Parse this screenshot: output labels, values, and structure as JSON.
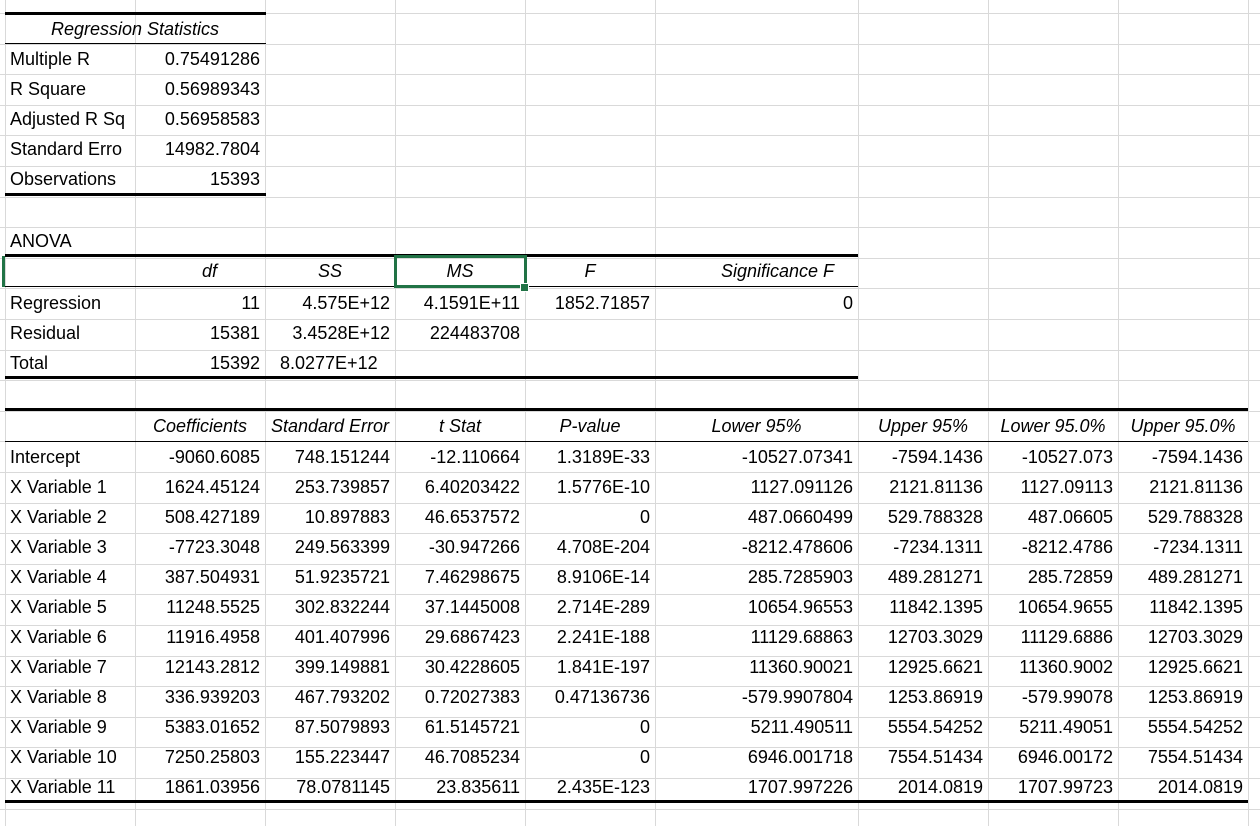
{
  "regression_statistics": {
    "title": "Regression Statistics",
    "rows": [
      {
        "label": "Multiple R",
        "value": "0.75491286"
      },
      {
        "label": "R Square",
        "value": "0.56989343"
      },
      {
        "label": "Adjusted R Sq",
        "value": "0.56958583"
      },
      {
        "label": "Standard Erro",
        "value": "14982.7804"
      },
      {
        "label": "Observations",
        "value": "15393"
      }
    ]
  },
  "anova": {
    "title": "ANOVA",
    "headers": [
      "df",
      "SS",
      "MS",
      "F",
      "Significance F"
    ],
    "rows": [
      {
        "label": "Regression",
        "df": "11",
        "ss": "4.575E+12",
        "ms": "4.1591E+11",
        "f": "1852.71857",
        "sig": "0"
      },
      {
        "label": "Residual",
        "df": "15381",
        "ss": "3.4528E+12",
        "ms": "224483708",
        "f": "",
        "sig": ""
      },
      {
        "label": "Total",
        "df": "15392",
        "ss": "8.0277E+12",
        "ms": "",
        "f": "",
        "sig": ""
      }
    ]
  },
  "coefficients": {
    "headers": [
      "Coefficients",
      "Standard Error",
      "t Stat",
      "P-value",
      "Lower 95%",
      "Upper 95%",
      "Lower 95.0%",
      "Upper 95.0%"
    ],
    "rows": [
      {
        "label": "Intercept",
        "v": [
          "-9060.6085",
          "748.151244",
          "-12.110664",
          "1.3189E-33",
          "-10527.07341",
          "-7594.1436",
          "-10527.073",
          "-7594.1436"
        ]
      },
      {
        "label": "X Variable 1",
        "v": [
          "1624.45124",
          "253.739857",
          "6.40203422",
          "1.5776E-10",
          "1127.091126",
          "2121.81136",
          "1127.09113",
          "2121.81136"
        ]
      },
      {
        "label": "X Variable 2",
        "v": [
          "508.427189",
          "10.897883",
          "46.6537572",
          "0",
          "487.0660499",
          "529.788328",
          "487.06605",
          "529.788328"
        ]
      },
      {
        "label": "X Variable 3",
        "v": [
          "-7723.3048",
          "249.563399",
          "-30.947266",
          "4.708E-204",
          "-8212.478606",
          "-7234.1311",
          "-8212.4786",
          "-7234.1311"
        ]
      },
      {
        "label": "X Variable 4",
        "v": [
          "387.504931",
          "51.9235721",
          "7.46298675",
          "8.9106E-14",
          "285.7285903",
          "489.281271",
          "285.72859",
          "489.281271"
        ]
      },
      {
        "label": "X Variable 5",
        "v": [
          "11248.5525",
          "302.832244",
          "37.1445008",
          "2.714E-289",
          "10654.96553",
          "11842.1395",
          "10654.9655",
          "11842.1395"
        ]
      },
      {
        "label": "X Variable 6",
        "v": [
          "11916.4958",
          "401.407996",
          "29.6867423",
          "2.241E-188",
          "11129.68863",
          "12703.3029",
          "11129.6886",
          "12703.3029"
        ]
      },
      {
        "label": "X Variable 7",
        "v": [
          "12143.2812",
          "399.149881",
          "30.4228605",
          "1.841E-197",
          "11360.90021",
          "12925.6621",
          "11360.9002",
          "12925.6621"
        ]
      },
      {
        "label": "X Variable 8",
        "v": [
          "336.939203",
          "467.793202",
          "0.72027383",
          "0.47136736",
          "-579.9907804",
          "1253.86919",
          "-579.99078",
          "1253.86919"
        ]
      },
      {
        "label": "X Variable 9",
        "v": [
          "5383.01652",
          "87.5079893",
          "61.5145721",
          "0",
          "5211.490511",
          "5554.54252",
          "5211.49051",
          "5554.54252"
        ]
      },
      {
        "label": "X Variable 10",
        "v": [
          "7250.25803",
          "155.223447",
          "46.7085234",
          "0",
          "6946.001718",
          "7554.51434",
          "6946.00172",
          "7554.51434"
        ]
      },
      {
        "label": "X Variable 11",
        "v": [
          "1861.03956",
          "78.0781145",
          "23.835611",
          "2.435E-123",
          "1707.997226",
          "2014.0819",
          "1707.99723",
          "2014.0819"
        ]
      }
    ]
  },
  "colors": {
    "selection": "#217346",
    "gridline": "#d9d9d9"
  }
}
